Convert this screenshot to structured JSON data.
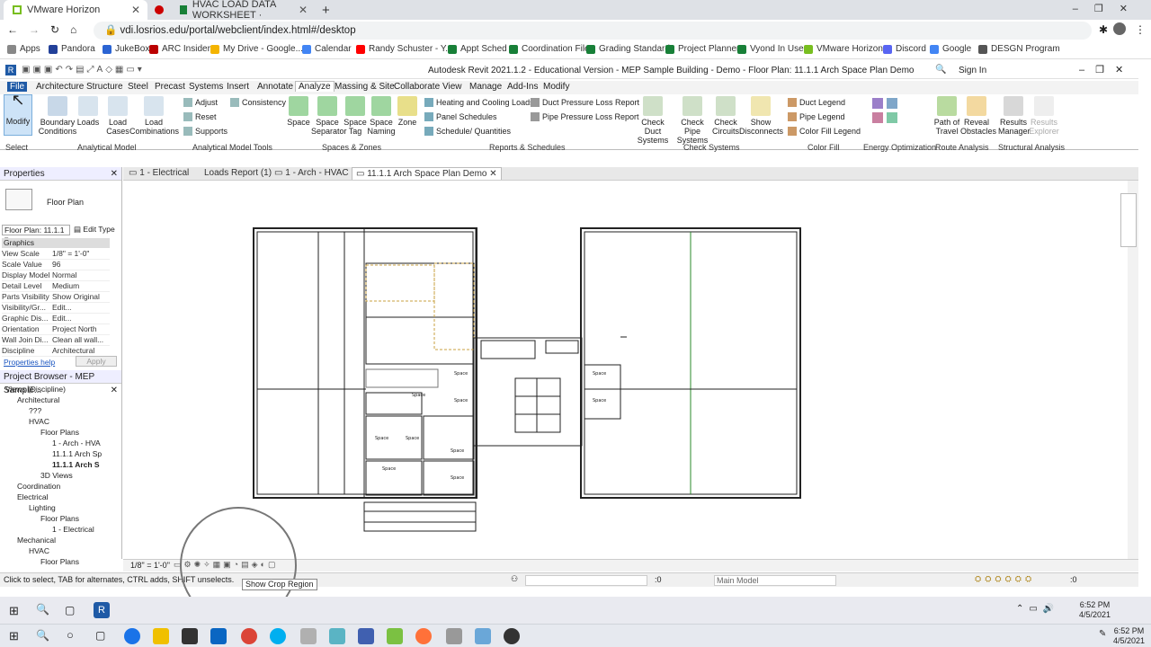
{
  "browser": {
    "tabs": [
      {
        "label": "VMware Horizon"
      },
      {
        "label": "HVAC LOAD DATA WORKSHEET ·"
      }
    ],
    "url": "vdi.losrios.edu/portal/webclient/index.html#/desktop",
    "bookmarks": [
      "Apps",
      "Pandora",
      "JukeBox",
      "ARC Insider",
      "My Drive - Google...",
      "Calendar",
      "Randy Schuster - Y...",
      "Appt Sched",
      "Coordination File",
      "Grading Standard",
      "Project Planner",
      "Vyond In Use",
      "VMware Horizon",
      "Discord",
      "Google",
      "DESGN Program"
    ]
  },
  "revit": {
    "title": "Autodesk Revit 2021.1.2 - Educational Version - MEP Sample Building - Demo - Floor Plan: 11.1.1 Arch Space Plan Demo",
    "sign_in": "Sign In",
    "ribbon_tabs": [
      "File",
      "Architecture",
      "Structure",
      "Steel",
      "Precast",
      "Systems",
      "Insert",
      "Annotate",
      "Analyze",
      "Massing & Site",
      "Collaborate",
      "View",
      "Manage",
      "Add-Ins",
      "Modify"
    ],
    "active_tab": "Analyze",
    "ribbon_buttons": {
      "modify": "Modify",
      "boundary": "Boundary Conditions",
      "loads": "Loads",
      "load_cases": "Load Cases",
      "load_combinations": "Load Combinations",
      "adjust": "Adjust",
      "reset": "Reset",
      "supports": "Supports",
      "consistency": "Consistency",
      "space": "Space",
      "space_separator": "Space Separator",
      "space_tag": "Space Tag",
      "space_naming": "Space Naming",
      "zone": "Zone",
      "heating_cooling": "Heating and Cooling Loads",
      "panel_schedules": "Panel Schedules",
      "schedule_quantities": "Schedule/ Quantities",
      "duct_pressure": "Duct Pressure Loss Report",
      "pipe_pressure": "Pipe Pressure Loss Report",
      "check_duct": "Check Duct Systems",
      "check_pipe": "Check Pipe Systems",
      "check_circuits": "Check Circuits",
      "show_disconnects": "Show Disconnects",
      "duct_legend": "Duct Legend",
      "pipe_legend": "Pipe Legend",
      "color_fill_legend": "Color Fill Legend",
      "path_travel": "Path of Travel",
      "reveal_obstacles": "Reveal Obstacles",
      "results_manager": "Results Manager",
      "results_explorer": "Results Explorer"
    },
    "panels": [
      "Select",
      "Analytical Model",
      "Analytical Model Tools",
      "Spaces & Zones",
      "Reports & Schedules",
      "Check Systems",
      "Color Fill",
      "Energy Optimization",
      "Route Analysis",
      "Structural Analysis"
    ],
    "view_tabs": [
      "1 - Electrical",
      "Loads Report (1)",
      "1 - Arch - HVAC",
      "11.1.1 Arch Space Plan Demo"
    ],
    "properties": {
      "header": "Properties",
      "type": "Floor Plan",
      "selector": "Floor Plan: 11.1.1",
      "edit_type": "Edit Type",
      "section": "Graphics",
      "rows": [
        {
          "k": "View Scale",
          "v": "1/8\" = 1'-0\""
        },
        {
          "k": "Scale Value",
          "v": "96"
        },
        {
          "k": "Display Model",
          "v": "Normal"
        },
        {
          "k": "Detail Level",
          "v": "Medium"
        },
        {
          "k": "Parts Visibility",
          "v": "Show Original"
        },
        {
          "k": "Visibility/Gr...",
          "v": "Edit..."
        },
        {
          "k": "Graphic Dis...",
          "v": "Edit..."
        },
        {
          "k": "Orientation",
          "v": "Project North"
        },
        {
          "k": "Wall Join Di...",
          "v": "Clean all wall..."
        },
        {
          "k": "Discipline",
          "v": "Architectural"
        }
      ],
      "help": "Properties help",
      "apply": "Apply"
    },
    "project_browser": {
      "header": "Project Browser - MEP Sample...",
      "items": [
        {
          "label": "Views (Discipline)",
          "lvl": 0
        },
        {
          "label": "Architectural",
          "lvl": 1
        },
        {
          "label": "???",
          "lvl": 2
        },
        {
          "label": "HVAC",
          "lvl": 2
        },
        {
          "label": "Floor Plans",
          "lvl": 3
        },
        {
          "label": "1 - Arch - HVA",
          "lvl": 4
        },
        {
          "label": "11.1.1 Arch Sp",
          "lvl": 4
        },
        {
          "label": "11.1.1 Arch S",
          "lvl": 4
        },
        {
          "label": "3D Views",
          "lvl": 3
        },
        {
          "label": "Coordination",
          "lvl": 1
        },
        {
          "label": "Electrical",
          "lvl": 1
        },
        {
          "label": "Lighting",
          "lvl": 2
        },
        {
          "label": "Floor Plans",
          "lvl": 3
        },
        {
          "label": "1 - Electrical",
          "lvl": 4
        },
        {
          "label": "Mechanical",
          "lvl": 1
        },
        {
          "label": "HVAC",
          "lvl": 2
        },
        {
          "label": "Floor Plans",
          "lvl": 3
        }
      ]
    },
    "view_scale": "1/8\" = 1'-0\"",
    "status_text": "Click to select, TAB for alternates, CTRL adds, SHIFT unselects.",
    "tooltip": "Show Crop Region",
    "workset": ":0",
    "model": "Main Model",
    "selection_count": ":0"
  },
  "clock": [
    {
      "time": "6:52 PM",
      "date": "4/5/2021"
    },
    {
      "time": "6:52 PM",
      "date": "4/5/2021"
    }
  ],
  "plan_labels": [
    "Space",
    "Space",
    "Space",
    "Space",
    "Space",
    "Space",
    "Space",
    "Space",
    "Space",
    "Space"
  ]
}
